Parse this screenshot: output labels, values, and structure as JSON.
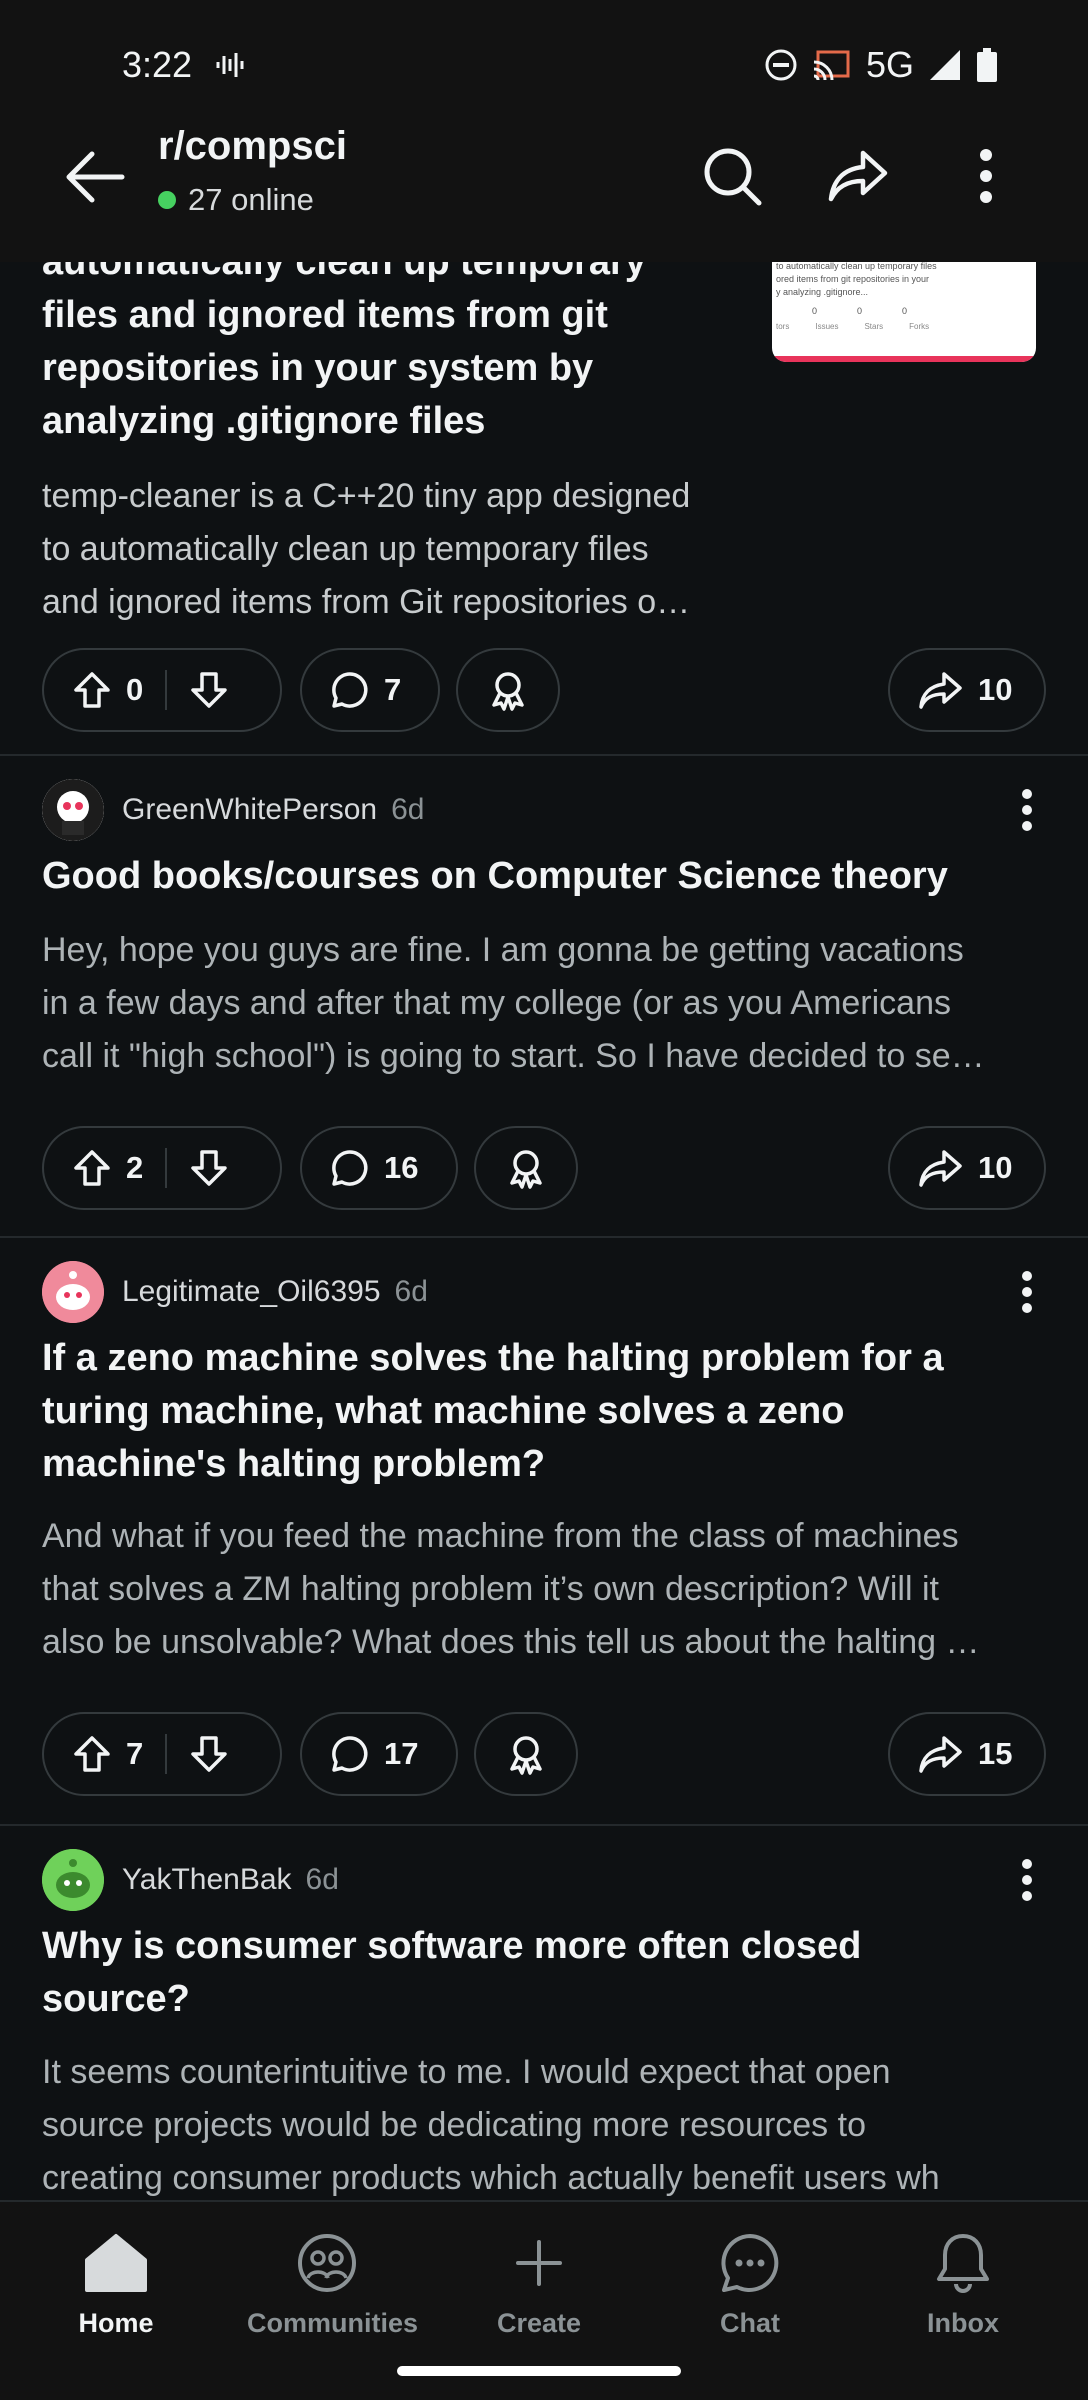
{
  "status_bar": {
    "time": "3:22",
    "network": "5G"
  },
  "header": {
    "subreddit": "r/compsci",
    "online": "27 online"
  },
  "posts": [
    {
      "title_lines": [
        "automatically clean up temporary",
        "files and ignored items from git",
        "repositories in your system by",
        "analyzing .gitignore files"
      ],
      "body_lines": [
        "temp-cleaner is a C++20 tiny app designed",
        "to automatically clean up temporary files",
        "and ignored items from Git repositories o…"
      ],
      "thumb_lines": [
        "to automatically clean up temporary files",
        "ored items from git repositories in your",
        "y analyzing .gitignore..."
      ],
      "thumb_stats": [
        "0",
        "0",
        "0"
      ],
      "thumb_labels": [
        "tors",
        "Issues",
        "Stars",
        "Forks"
      ],
      "votes": "0",
      "comments": "7",
      "shares": "10"
    },
    {
      "author": "GreenWhitePerson",
      "age": "6d",
      "title_lines": [
        "Good books/courses on Computer Science theory"
      ],
      "body_lines": [
        "Hey, hope you guys are fine. I am gonna be getting vacations",
        "in a few days and after that my college (or as you Americans",
        "call it \"high school\") is going to start. So I have decided to se…"
      ],
      "votes": "2",
      "comments": "16",
      "shares": "10",
      "avatar_color": "#ffffff"
    },
    {
      "author": "Legitimate_Oil6395",
      "age": "6d",
      "title_lines": [
        "If a zeno machine solves the halting problem for a",
        "turing machine, what machine solves a zeno",
        "machine's halting problem?"
      ],
      "body_lines": [
        "And what if you feed the machine from the class of machines",
        "that solves a ZM halting problem it’s own description? Will it",
        "also be unsolvable? What does this tell us about the halting …"
      ],
      "votes": "7",
      "comments": "17",
      "shares": "15",
      "avatar_color": "#f08a9b"
    },
    {
      "author": "YakThenBak",
      "age": "6d",
      "title_lines": [
        "Why is consumer software more often closed",
        "source?"
      ],
      "body_lines": [
        "It seems counterintuitive to me. I would expect that open",
        "source projects would be dedicating more resources to",
        "creating consumer products which actually benefit users wh"
      ],
      "avatar_color": "#6fd15a"
    }
  ],
  "nav": {
    "home": "Home",
    "communities": "Communities",
    "create": "Create",
    "chat": "Chat",
    "inbox": "Inbox"
  },
  "colors": {
    "accent_online": "#46d160",
    "background": "#0e1113"
  }
}
